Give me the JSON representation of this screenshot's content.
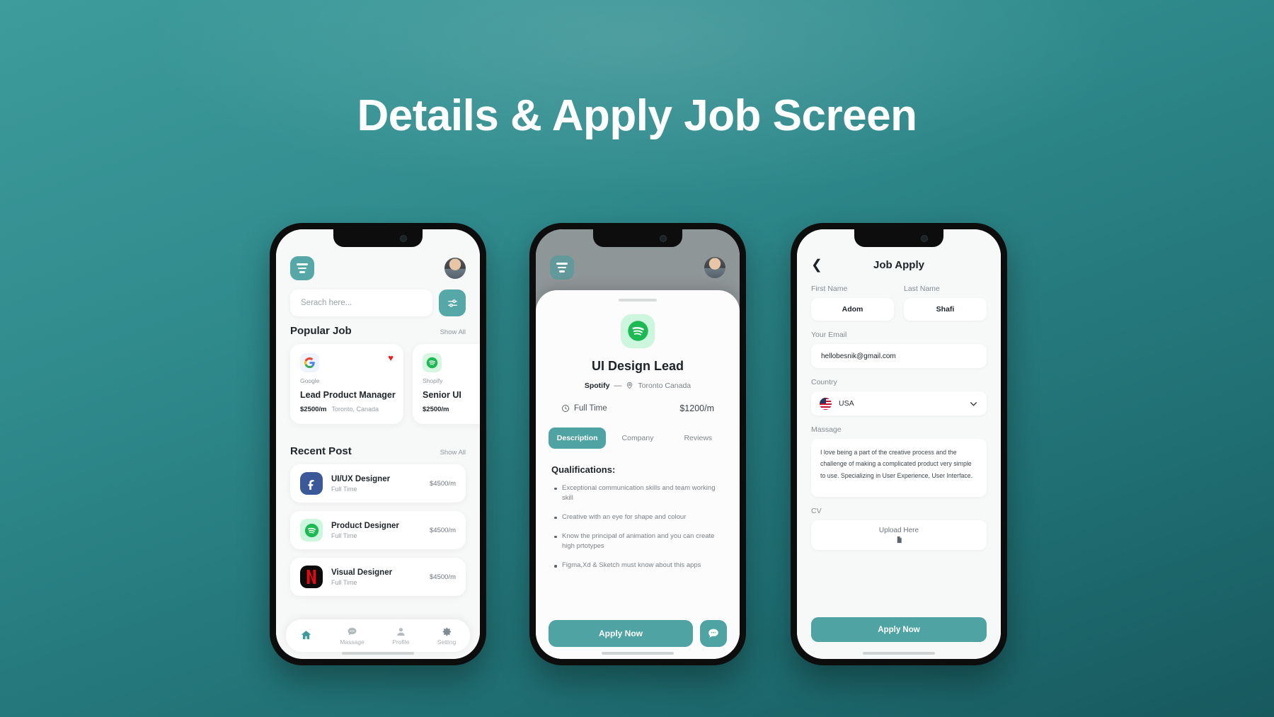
{
  "header": {
    "title": "Details & Apply Job Screen"
  },
  "screen1": {
    "icons": {
      "menu": "hamburger-menu-icon",
      "avatar": "user-avatar",
      "filter": "filter-sliders-icon"
    },
    "search": {
      "placeholder": "Serach here...",
      "value": ""
    },
    "popular": {
      "title": "Popular Job",
      "show_all": "Show All",
      "cards": [
        {
          "company": "Google",
          "logo": "google-logo",
          "title": "Lead Product Manager",
          "salary": "$2500/m",
          "location": "Toronto, Canada",
          "favorite": true
        },
        {
          "company": "Shopify",
          "logo": "spotify-logo",
          "title": "Senior UI",
          "salary": "$2500/m",
          "location": "",
          "favorite": true
        }
      ]
    },
    "recent": {
      "title": "Recent Post",
      "show_all": "Show All",
      "items": [
        {
          "logo": "facebook-logo",
          "title": "UI/UX Designer",
          "type": "Full Time",
          "salary": "$4500/m"
        },
        {
          "logo": "spotify-logo",
          "title": "Product Designer",
          "type": "Full Time",
          "salary": "$4500/m"
        },
        {
          "logo": "netflix-logo",
          "title": "Visual Designer",
          "type": "Full Time",
          "salary": "$4500/m"
        }
      ]
    },
    "nav": [
      {
        "icon": "home-icon",
        "label": "",
        "active": true
      },
      {
        "icon": "chat-bubble-icon",
        "label": "Massage",
        "active": false
      },
      {
        "icon": "person-icon",
        "label": "Profile",
        "active": false
      },
      {
        "icon": "gear-icon",
        "label": "Setting",
        "active": false
      }
    ]
  },
  "screen2": {
    "logo": "spotify-logo",
    "job_title": "UI Design Lead",
    "company": "Spotify",
    "separator": "—",
    "location": "Toronto Canada",
    "employment_type": "Full Time",
    "salary": "$1200/m",
    "tabs": [
      {
        "label": "Description",
        "active": true
      },
      {
        "label": "Company",
        "active": false
      },
      {
        "label": "Reviews",
        "active": false
      }
    ],
    "qualifications_heading": "Qualifications:",
    "qualifications": [
      "Exceptional communication skills and team working skill",
      "Creative with an eye for shape and colour",
      "Know the principal of animation and you can create high prtotypes",
      "Figma,Xd & Sketch must know about this apps"
    ],
    "apply_label": "Apply Now",
    "chat_icon": "chat-bubble-icon"
  },
  "screen3": {
    "title": "Job Apply",
    "back_icon": "chevron-left-icon",
    "first_name": {
      "label": "First Name",
      "value": "Adom"
    },
    "last_name": {
      "label": "Last Name",
      "value": "Shafi"
    },
    "email": {
      "label": "Your Email",
      "value": "hellobesnik@gmail.com"
    },
    "country": {
      "label": "Country",
      "value": "USA",
      "flag": "usa-flag-icon",
      "chevron": "chevron-down-icon"
    },
    "massage": {
      "label": "Massage",
      "value": "I love being a part of the creative process and the challenge of making a complicated product very simple to use. Specializing in User Experience, User Interface."
    },
    "cv": {
      "label": "CV",
      "upload_text": "Upload Here",
      "icon": "document-icon"
    },
    "apply_label": "Apply Now"
  },
  "colors": {
    "accent": "#50a3a3",
    "background_top": "#3e9c9c",
    "background_bottom": "#17595e",
    "heart": "#f01c1c",
    "spotify_green": "#1DB954"
  }
}
